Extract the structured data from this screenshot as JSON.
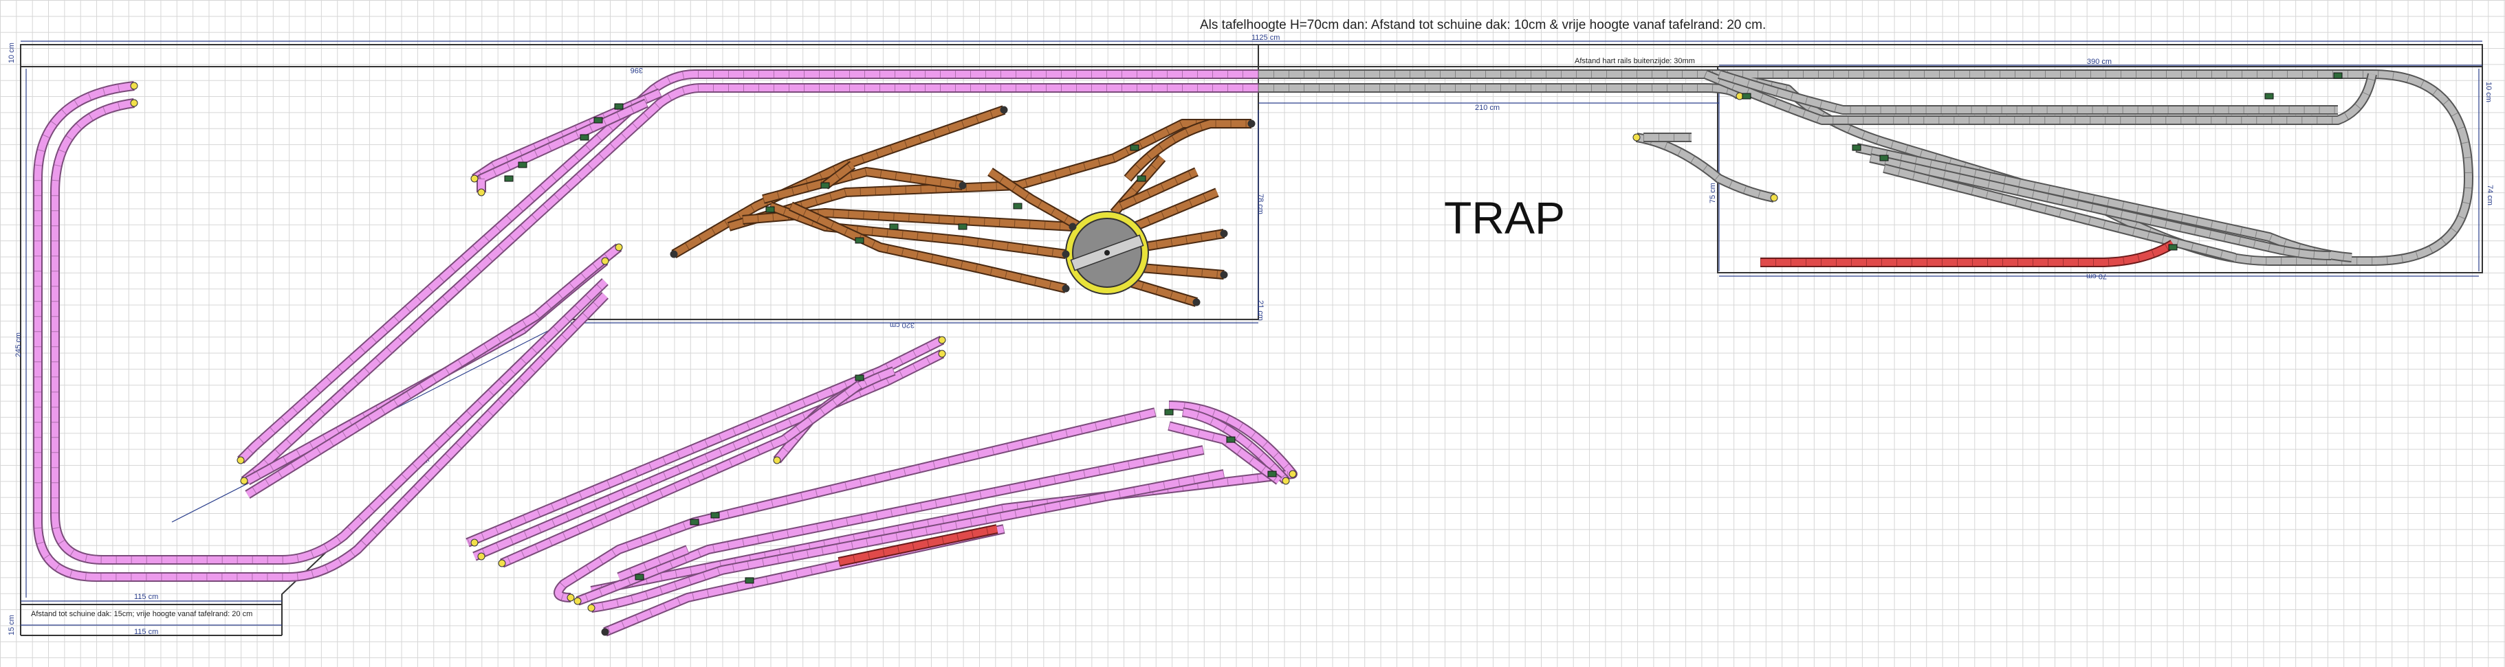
{
  "header": {
    "title": "Als tafelhoogte H=70cm dan:  Afstand tot schuine dak: 10cm & vrije hoogte vanaf tafelrand: 20 cm."
  },
  "labels": {
    "trap": "TRAP",
    "bottom_note": "Afstand tot schuine dak: 15cm; vrije hoogte vanaf tafelrand: 20 cm",
    "rail_note": "Afstand hart rails buitenzijde: 30mm"
  },
  "dimensions": {
    "total_width": "1125 cm",
    "top_left_height": "10 cm",
    "left_height": "245 cm",
    "width_115_top": "115 cm",
    "width_115_bottom": "115 cm",
    "bottom_left_height": "15 cm",
    "yard_width": "320 cm",
    "yard_height": "78 cm",
    "yard_right_small": "21 cm",
    "mid_210": "210 cm",
    "right_390": "390 cm",
    "right_height": "75 cm",
    "right_bottom": "70 cm",
    "right_side": "74 cm",
    "right_top_small": "10 cm",
    "diag_left": "151 cm",
    "mid_small": "396"
  },
  "colors": {
    "pink_track": "#ec9bec",
    "pink_outline": "#7a4b7a",
    "brown_track": "#b8733b",
    "brown_outline": "#4a2a12",
    "grey_track": "#b9b9b9",
    "grey_outline": "#555555",
    "red_track": "#e04a4a",
    "turntable_ring": "#e8e23a",
    "dimension_blue": "#2b3f8c",
    "switch_green": "#2f6b3a"
  },
  "icons": [
    "turntable-icon",
    "buffer-stop-icon",
    "switch-motor-icon"
  ]
}
